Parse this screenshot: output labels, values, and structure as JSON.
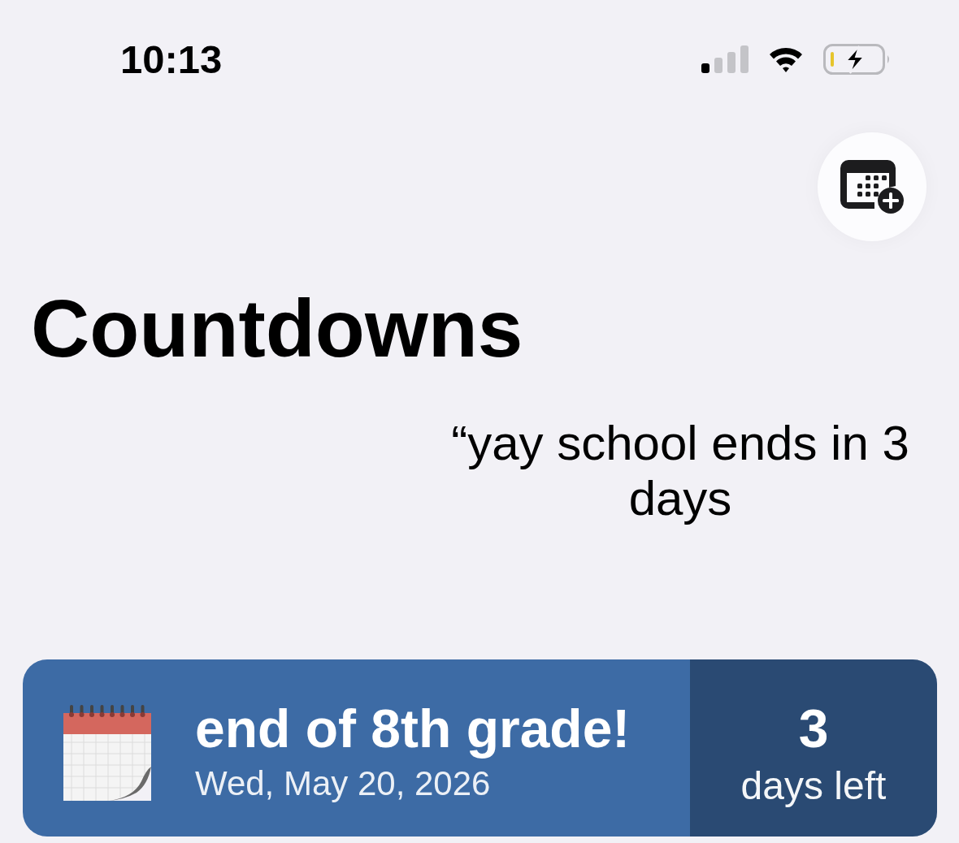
{
  "status_bar": {
    "time": "10:13"
  },
  "title": "Countdowns",
  "caption": "“yay school ends in 3 days",
  "countdowns": [
    {
      "title": "end of 8th grade!",
      "date": "Wed, May 20, 2026",
      "count": "3",
      "unit": "days left",
      "color": "#3d6ba5"
    }
  ]
}
